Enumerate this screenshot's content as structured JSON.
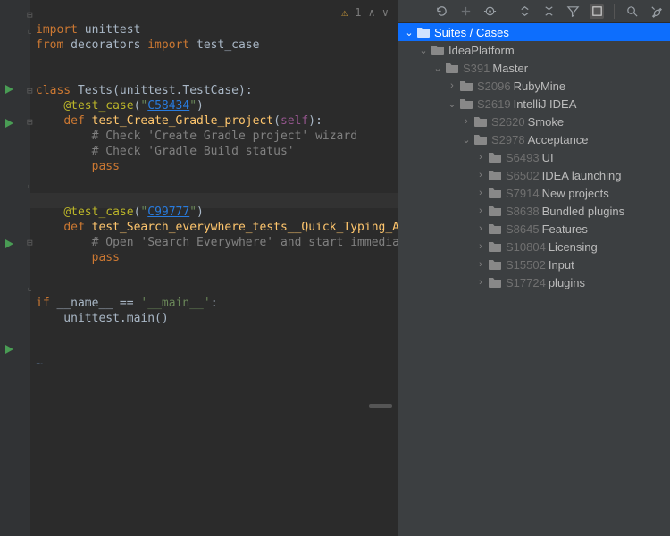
{
  "editor": {
    "warnings": "1",
    "lines": {
      "l1a": "import",
      "l1b": " unittest",
      "l2a": "from",
      "l2b": " decorators ",
      "l2c": "import",
      "l2d": " test_case",
      "l5a": "class ",
      "l5b": "Tests",
      "l5c": "(unittest.TestCase):",
      "l6a": "    ",
      "l6b": "@test_case",
      "l6c": "(",
      "l6d": "\"",
      "l6e": "C58434",
      "l6f": "\"",
      "l6g": ")",
      "l7a": "    ",
      "l7b": "def ",
      "l7c": "test_Create_Gradle_project",
      "l7d": "(",
      "l7e": "self",
      "l7f": "):",
      "l8a": "        ",
      "l8b": "# Check 'Create Gradle project' wizard",
      "l9a": "        ",
      "l9b": "# Check 'Gradle Build status'",
      "l10a": "        ",
      "l10b": "pass",
      "l12a": "    ",
      "l12b": "@test_case",
      "l12c": "(",
      "l12d": "\"",
      "l12e": "C99777",
      "l12f": "\"",
      "l12g": ")",
      "l13a": "    ",
      "l13b": "def ",
      "l13c": "test_Search_everywhere_tests__Quick_Typing_A",
      "l13d": "",
      "l14a": "        ",
      "l14b": "# Open 'Search Everywhere' and start immedia",
      "l15a": "        ",
      "l15b": "pass",
      "l18a": "if ",
      "l18b": "__name__",
      "l18c": " == ",
      "l18d": "'__main__'",
      "l18e": ":",
      "l19a": "    unittest.main()",
      "tilde": "~"
    }
  },
  "tree": {
    "root": "Suites / Cases",
    "items": [
      {
        "depth": 1,
        "arrow": "down",
        "id": "",
        "label": "IdeaPlatform"
      },
      {
        "depth": 2,
        "arrow": "down",
        "id": "S391",
        "label": "Master"
      },
      {
        "depth": 3,
        "arrow": "right",
        "id": "S2096",
        "label": "RubyMine"
      },
      {
        "depth": 3,
        "arrow": "down",
        "id": "S2619",
        "label": "IntelliJ IDEA"
      },
      {
        "depth": 4,
        "arrow": "right",
        "id": "S2620",
        "label": "Smoke"
      },
      {
        "depth": 4,
        "arrow": "down",
        "id": "S2978",
        "label": "Acceptance"
      },
      {
        "depth": 5,
        "arrow": "right",
        "id": "S6493",
        "label": "UI"
      },
      {
        "depth": 5,
        "arrow": "right",
        "id": "S6502",
        "label": "IDEA launching"
      },
      {
        "depth": 5,
        "arrow": "right",
        "id": "S7914",
        "label": "New projects"
      },
      {
        "depth": 5,
        "arrow": "right",
        "id": "S8638",
        "label": "Bundled plugins"
      },
      {
        "depth": 5,
        "arrow": "right",
        "id": "S8645",
        "label": "Features"
      },
      {
        "depth": 5,
        "arrow": "right",
        "id": "S10804",
        "label": "Licensing"
      },
      {
        "depth": 5,
        "arrow": "right",
        "id": "S15502",
        "label": "Input"
      },
      {
        "depth": 5,
        "arrow": "right",
        "id": "S17724",
        "label": "plugins"
      }
    ]
  }
}
